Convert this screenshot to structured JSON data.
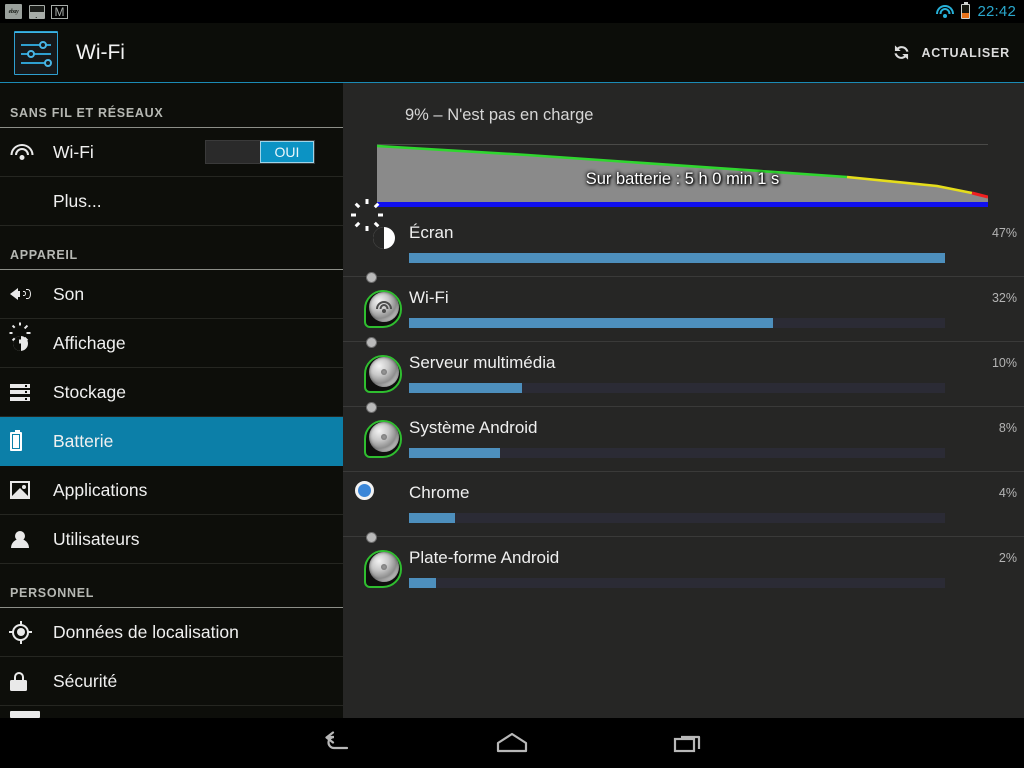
{
  "status_bar": {
    "notifications": [
      {
        "name": "ebay-notification-icon",
        "label": "ebay"
      },
      {
        "name": "gallery-notification-icon",
        "label": ""
      },
      {
        "name": "gmail-notification-icon",
        "label": "M"
      }
    ],
    "wifi_icon": "wifi-icon",
    "battery_icon": "battery-icon",
    "battery_color": "#e8731a",
    "clock": "22:42",
    "clock_color": "#2aa7cc"
  },
  "action_bar": {
    "icon": "settings-sliders-icon",
    "title": "Wi-Fi",
    "refresh_label": "ACTUALISER",
    "refresh_icon": "refresh-icon",
    "accent": "#1b8ab5"
  },
  "sidebar": {
    "sections": [
      {
        "header": "SANS FIL ET RÉSEAUX",
        "items": [
          {
            "id": "wifi",
            "label": "Wi-Fi",
            "icon": "wifi-icon",
            "selected": false,
            "toggle": {
              "value": "OUI",
              "on": true
            }
          },
          {
            "id": "plus",
            "label": "Plus...",
            "icon": "",
            "selected": false
          }
        ]
      },
      {
        "header": "APPAREIL",
        "items": [
          {
            "id": "son",
            "label": "Son",
            "icon": "sound-icon",
            "selected": false
          },
          {
            "id": "affichage",
            "label": "Affichage",
            "icon": "brightness-icon",
            "selected": false
          },
          {
            "id": "stockage",
            "label": "Stockage",
            "icon": "storage-icon",
            "selected": false
          },
          {
            "id": "batterie",
            "label": "Batterie",
            "icon": "battery-icon",
            "selected": true
          },
          {
            "id": "applications",
            "label": "Applications",
            "icon": "apps-image-icon",
            "selected": false
          },
          {
            "id": "utilisateurs",
            "label": "Utilisateurs",
            "icon": "user-icon",
            "selected": false
          }
        ]
      },
      {
        "header": "PERSONNEL",
        "items": [
          {
            "id": "localisation",
            "label": "Données de localisation",
            "icon": "location-crosshair-icon",
            "selected": false
          },
          {
            "id": "securite",
            "label": "Sécurité",
            "icon": "lock-icon",
            "selected": false
          }
        ]
      }
    ],
    "selected_color": "#0c7fa8"
  },
  "battery": {
    "status_text": "9% – N'est pas en charge",
    "level_percent": 9,
    "graph_label": "Sur batterie : 5 h 0 min 1 s",
    "graph": {
      "line_colors": {
        "good": "#2fd62f",
        "warn": "#e5dd1b",
        "critical": "#f02020"
      },
      "fill_color": "#8a8a8a",
      "screen_on_bar_color": "#1010ee"
    },
    "consumers": [
      {
        "name": "Écran",
        "percent": "47%",
        "value": 47,
        "bar_ratio": 1.0,
        "icon": "screen-brightness-icon"
      },
      {
        "name": "Wi-Fi",
        "percent": "32%",
        "value": 32,
        "bar_ratio": 0.68,
        "icon": "android-wifi-icon"
      },
      {
        "name": "Serveur multimédia",
        "percent": "10%",
        "value": 10,
        "bar_ratio": 0.21,
        "icon": "android-system-icon"
      },
      {
        "name": "Système Android",
        "percent": "8%",
        "value": 8,
        "bar_ratio": 0.17,
        "icon": "android-system-icon"
      },
      {
        "name": "Chrome",
        "percent": "4%",
        "value": 4,
        "bar_ratio": 0.085,
        "icon": "chrome-icon"
      },
      {
        "name": "Plate-forme Android",
        "percent": "2%",
        "value": 2,
        "bar_ratio": 0.05,
        "icon": "android-system-icon"
      }
    ],
    "bar_fill_color": "#4d8fbd",
    "bar_track_color": "#2b2b35"
  },
  "nav_bar": {
    "buttons": [
      {
        "name": "back-button",
        "icon": "back-arrow-icon"
      },
      {
        "name": "home-button",
        "icon": "home-icon"
      },
      {
        "name": "recents-button",
        "icon": "recents-icon"
      }
    ]
  }
}
